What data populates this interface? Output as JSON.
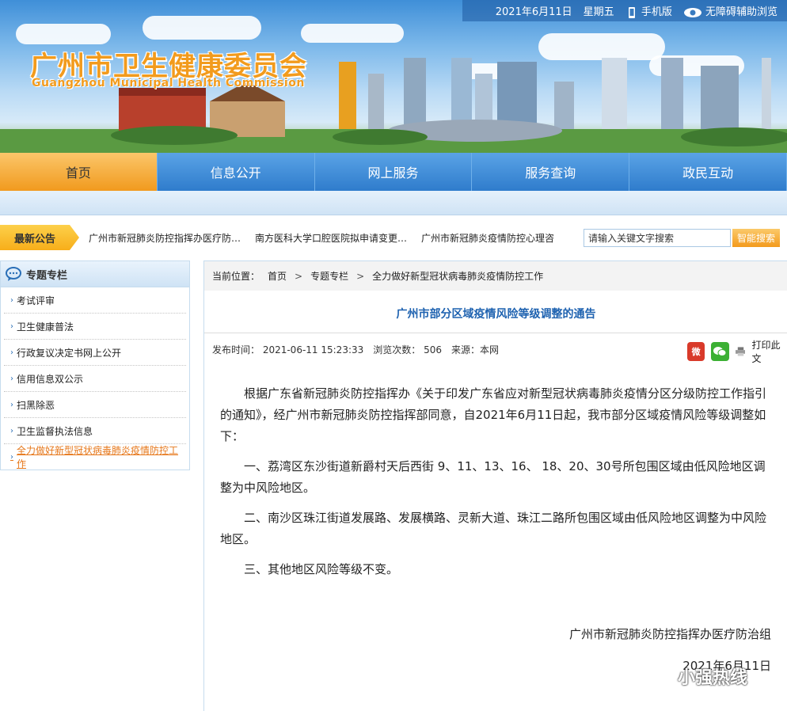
{
  "topbar": {
    "date": "2021年6月11日",
    "weekday": "星期五",
    "mobile": "手机版",
    "accessibility": "无障碍辅助浏览"
  },
  "logo": {
    "cn": "广州市卫生健康委员会",
    "en": "Guangzhou Municipal Health Commission"
  },
  "nav": [
    {
      "label": "首页"
    },
    {
      "label": "信息公开"
    },
    {
      "label": "网上服务"
    },
    {
      "label": "服务查询"
    },
    {
      "label": "政民互动"
    }
  ],
  "notice": {
    "label": "最新公告",
    "items": [
      "广州市新冠肺炎防控指挥办医疗防…",
      "南方医科大学口腔医院拟申请变更…",
      "广州市新冠肺炎疫情防控心理咨"
    ]
  },
  "search": {
    "placeholder": "请输入关键文字搜索",
    "button": "智能搜索"
  },
  "sidebar": {
    "title": "专题专栏",
    "items": [
      "考试评审",
      "卫生健康普法",
      "行政复议决定书网上公开",
      "信用信息双公示",
      "扫黑除恶",
      "卫生监督执法信息",
      "全力做好新型冠状病毒肺炎疫情防控工作"
    ]
  },
  "breadcrumb": {
    "label": "当前位置：",
    "items": [
      "首页",
      "专题专栏",
      "全力做好新型冠状病毒肺炎疫情防控工作"
    ],
    "sep": ">"
  },
  "article": {
    "title": "广州市部分区域疫情风险等级调整的通告",
    "meta": {
      "publish": "发布时间： 2021-06-11 15:23:33",
      "views": "浏览次数： 506",
      "source": "来源：本网"
    },
    "print": "打印此文",
    "paragraphs": [
      "根据广东省新冠肺炎防控指挥办《关于印发广东省应对新型冠状病毒肺炎疫情分区分级防控工作指引的通知》，经广州市新冠肺炎防控指挥部同意，自2021年6月11日起，我市部分区域疫情风险等级调整如下：",
      "一、荔湾区东沙街道新爵村天后西街 9、11、13、16、 18、20、30号所包围区域由低风险地区调整为中风险地区。",
      "二、南沙区珠江街道发展路、发展横路、灵新大道、珠江二路所包围区域由低风险地区调整为中风险地区。",
      "三、其他地区风险等级不变。"
    ],
    "signature": "广州市新冠肺炎防控指挥办医疗防治组",
    "date": "2021年6月11日"
  },
  "watermark": "小强热线"
}
